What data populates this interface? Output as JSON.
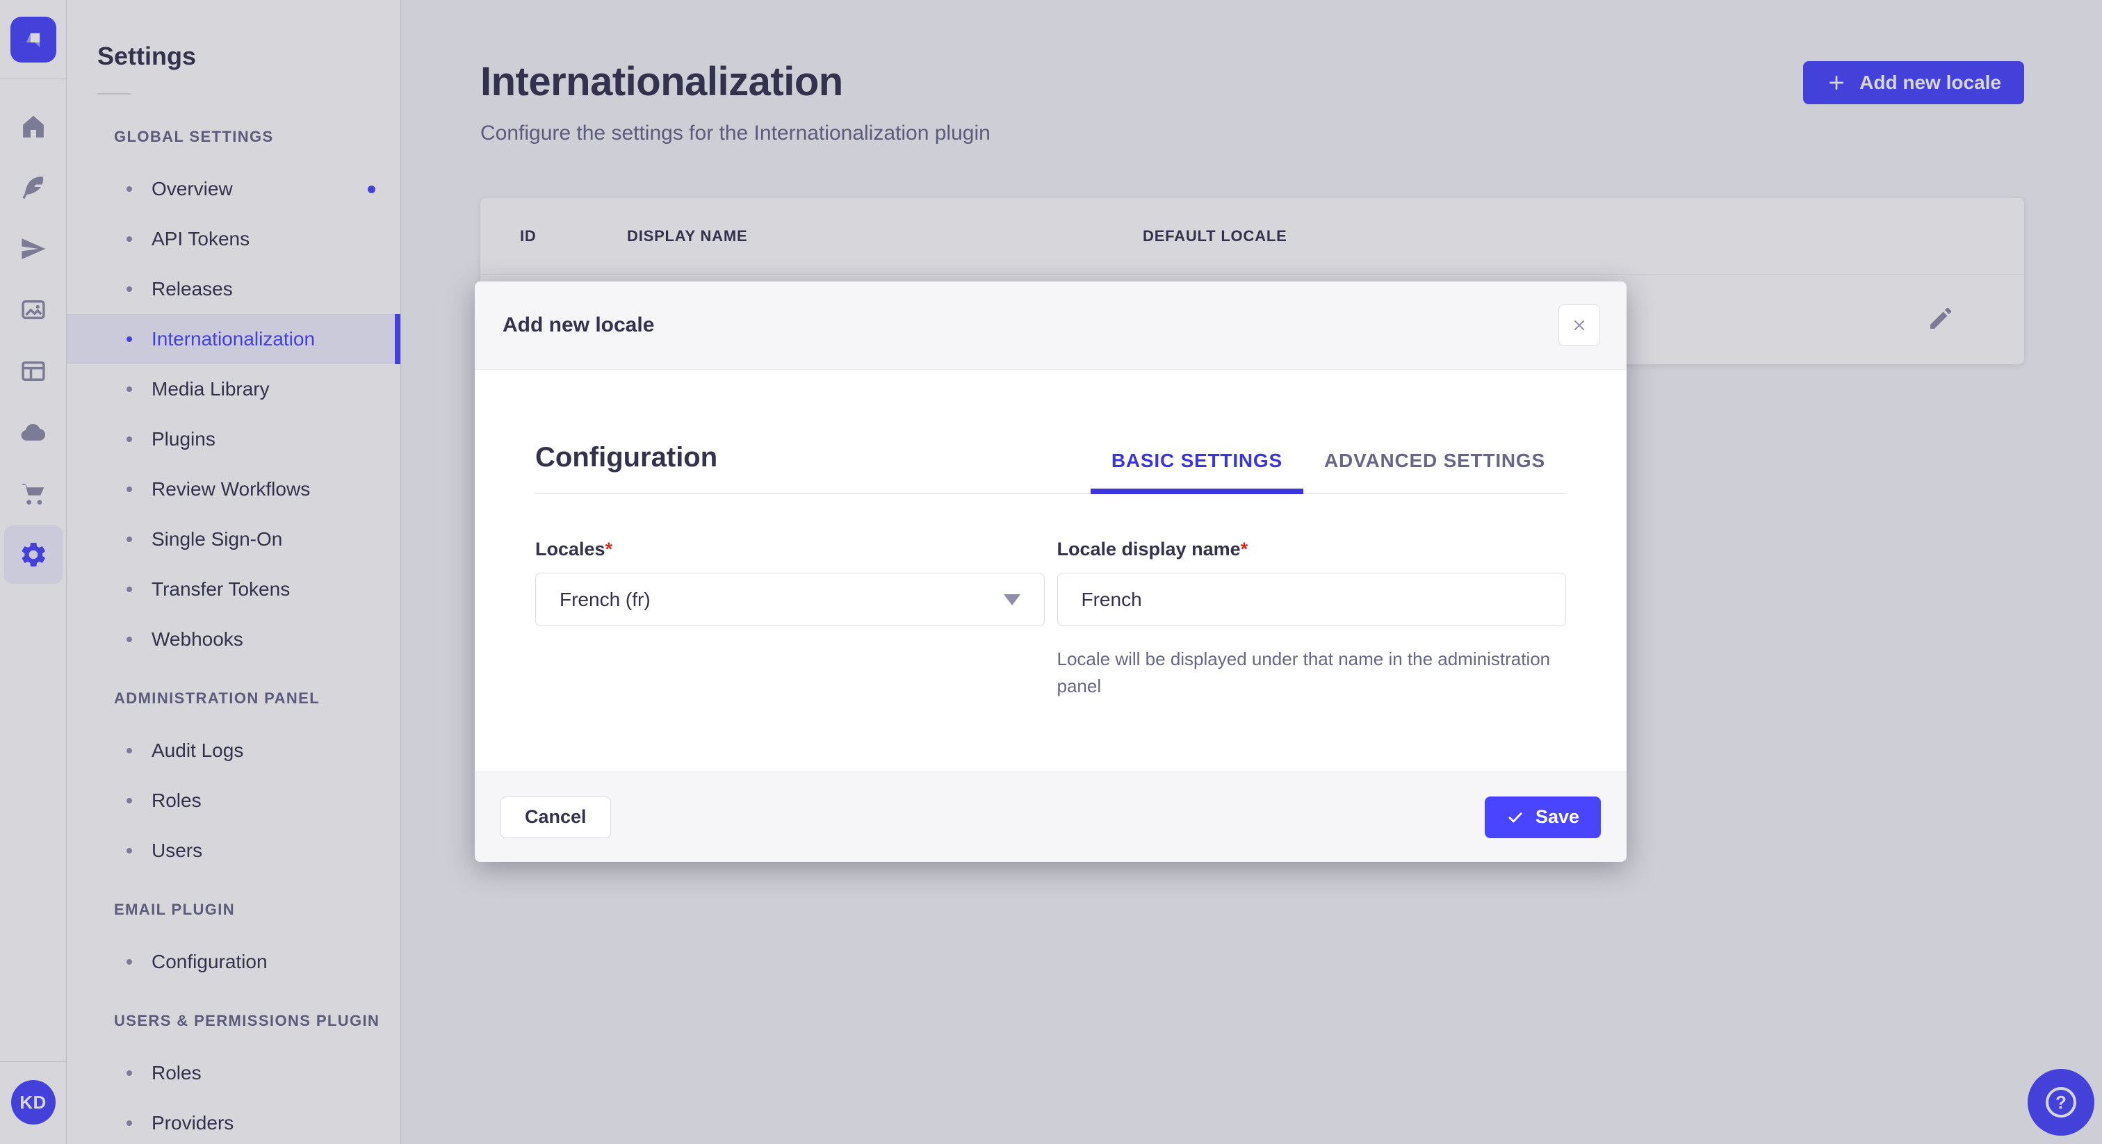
{
  "nav": {
    "icons": [
      "home-icon",
      "feather-icon",
      "paper-plane-icon",
      "media-library-icon",
      "layout-icon",
      "cloud-icon",
      "cart-icon",
      "settings-gear-icon"
    ],
    "active_icon": "settings-gear-icon",
    "avatar_initials": "KD"
  },
  "sidebar": {
    "title": "Settings",
    "sections": [
      {
        "label": "GLOBAL SETTINGS",
        "items": [
          {
            "label": "Overview",
            "has_notification_dot": true
          },
          {
            "label": "API Tokens"
          },
          {
            "label": "Releases"
          },
          {
            "label": "Internationalization",
            "active": true
          },
          {
            "label": "Media Library"
          },
          {
            "label": "Plugins"
          },
          {
            "label": "Review Workflows"
          },
          {
            "label": "Single Sign-On"
          },
          {
            "label": "Transfer Tokens"
          },
          {
            "label": "Webhooks"
          }
        ]
      },
      {
        "label": "ADMINISTRATION PANEL",
        "items": [
          {
            "label": "Audit Logs"
          },
          {
            "label": "Roles"
          },
          {
            "label": "Users"
          }
        ]
      },
      {
        "label": "EMAIL PLUGIN",
        "items": [
          {
            "label": "Configuration"
          }
        ]
      },
      {
        "label": "USERS & PERMISSIONS PLUGIN",
        "items": [
          {
            "label": "Roles"
          },
          {
            "label": "Providers"
          }
        ]
      }
    ]
  },
  "header": {
    "title": "Internationalization",
    "subtitle": "Configure the settings for the Internationalization plugin",
    "add_button": "Add new locale"
  },
  "table": {
    "columns": [
      "ID",
      "DISPLAY NAME",
      "DEFAULT LOCALE"
    ]
  },
  "modal": {
    "title": "Add new locale",
    "section_title": "Configuration",
    "tabs": [
      {
        "label": "BASIC SETTINGS",
        "active": true
      },
      {
        "label": "ADVANCED SETTINGS",
        "active": false
      }
    ],
    "required_mark": "*",
    "fields": {
      "locales_label": "Locales",
      "locales_value": "French (fr)",
      "display_name_label": "Locale display name",
      "display_name_value": "French",
      "display_name_hint": "Locale will be displayed under that name in the administration panel"
    },
    "cancel_label": "Cancel",
    "save_label": "Save"
  },
  "colors": {
    "accent": "#4945FF",
    "active_bg": "#F0F0FF",
    "text_dark": "#32324D",
    "text_muted": "#666687",
    "border": "#DCDCE4",
    "required": "#D02B20",
    "overlay": "rgba(50,50,77,0.2)"
  }
}
